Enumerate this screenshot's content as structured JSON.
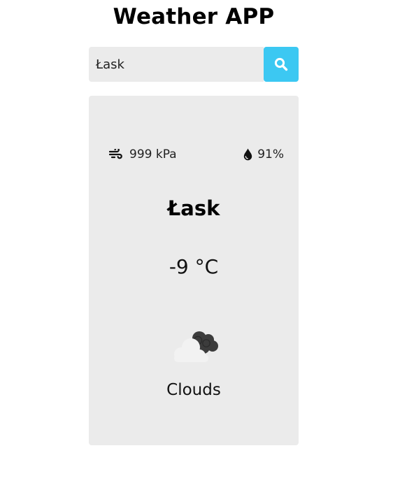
{
  "app": {
    "title": "Weather APP"
  },
  "search": {
    "value": "Łask",
    "icon": "search-icon",
    "button_color": "#3cc8f2"
  },
  "weather": {
    "pressure": "999 kPa",
    "pressure_icon": "wind-icon",
    "humidity": "91%",
    "humidity_icon": "water-drop-icon",
    "city": "Łask",
    "temperature": "-9 °C",
    "icon": "clouds-icon",
    "condition": "Clouds"
  },
  "colors": {
    "card_background": "#ebebeb",
    "accent": "#3cc8f2"
  }
}
